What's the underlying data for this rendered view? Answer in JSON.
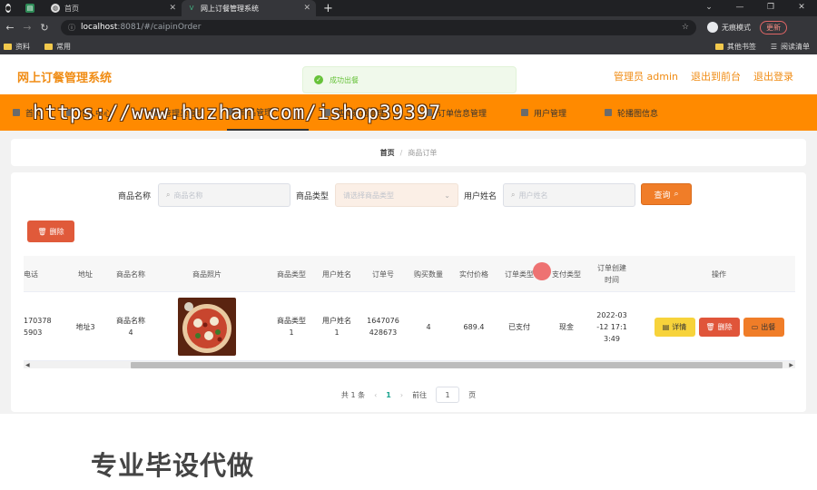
{
  "browser": {
    "tabs": [
      {
        "title": "",
        "active": false
      },
      {
        "title": "",
        "active": false
      },
      {
        "title": "首页",
        "active": false
      },
      {
        "title": "网上订餐管理系统",
        "active": true
      }
    ],
    "new_tab": "+",
    "url_host": "localhost",
    "url_path": ":8081/#/caipinOrder",
    "profile_label": "无痕模式",
    "update_label": "更新",
    "bookmarks": [
      "资料",
      "常用"
    ],
    "bookmarks_right": [
      "其他书签",
      "阅读清单"
    ]
  },
  "header": {
    "site_title": "网上订餐管理系统",
    "admin_label": "管理员 admin",
    "front_link": "退出到前台",
    "logout_link": "退出登录"
  },
  "toast": {
    "message": "成功出餐"
  },
  "menu": {
    "items": [
      "首页",
      "个人中心",
      "管理员管理",
      "商品管理",
      "基础数据管理",
      "订单信息管理",
      "用户管理",
      "轮播图信息"
    ],
    "active_index": 3
  },
  "watermark": "https://www.huzhan.com/ishop39397",
  "breadcrumb": {
    "home": "首页",
    "separator": "/",
    "current": "商品订单"
  },
  "search": {
    "name_label": "商品名称",
    "name_placeholder": "商品名称",
    "type_label": "商品类型",
    "type_placeholder": "请选择商品类型",
    "user_label": "用户姓名",
    "user_placeholder": "用户姓名",
    "query_button": "查询"
  },
  "actions": {
    "delete_button": "删除"
  },
  "table": {
    "headers": [
      "电话",
      "地址",
      "商品名称",
      "商品照片",
      "商品类型",
      "用户姓名",
      "订单号",
      "购买数量",
      "实付价格",
      "订单类型",
      "支付类型",
      "订单创建\n时间",
      "操作"
    ],
    "row": {
      "phone": "170378\n5903",
      "address": "地址3",
      "product_name": "商品名称\n4",
      "product_type": "商品类型\n1",
      "user_name": "用户姓名\n1",
      "order_no": "1647076\n428673",
      "quantity": "4",
      "price": "689.4",
      "order_type": "已支付",
      "pay_type": "现金",
      "created_at": "2022-03\n-12 17:1\n3:49"
    },
    "op_buttons": {
      "detail": "详情",
      "delete": "删除",
      "ship": "出餐"
    }
  },
  "pager": {
    "total": "共 1 条",
    "current_page": "1",
    "goto_label": "前往",
    "goto_value": "1",
    "page_suffix": "页"
  },
  "overlay_caption": "专业毕设代做",
  "colors": {
    "accent": "#ff8a00",
    "title": "#f08c14",
    "success": "#67c23a"
  }
}
